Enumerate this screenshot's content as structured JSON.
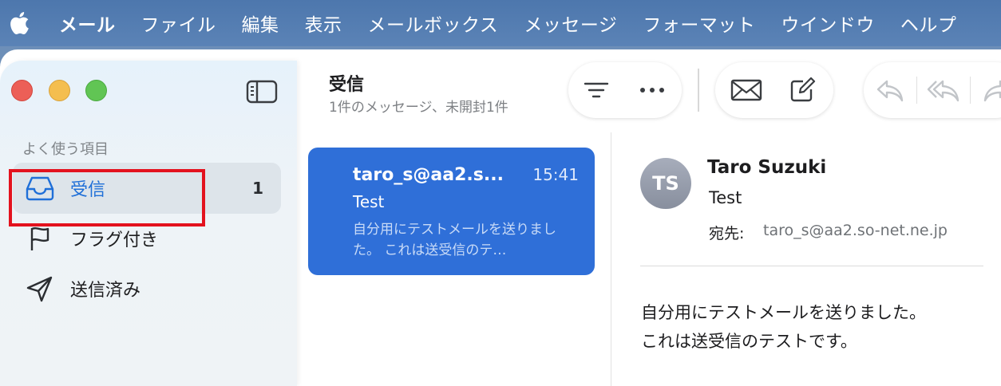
{
  "menubar": {
    "apple_icon": "apple-logo-icon",
    "items": [
      "メール",
      "ファイル",
      "編集",
      "表示",
      "メールボックス",
      "メッセージ",
      "フォーマット",
      "ウインドウ",
      "ヘルプ"
    ]
  },
  "sidebar": {
    "section_title": "よく使う項目",
    "items": [
      {
        "label": "受信",
        "icon": "inbox-tray-icon",
        "count": "1",
        "selected": true
      },
      {
        "label": "フラグ付き",
        "icon": "flag-icon",
        "count": ""
      },
      {
        "label": "送信済み",
        "icon": "paper-plane-icon",
        "count": ""
      }
    ]
  },
  "toolbar": {
    "title": "受信",
    "subtitle": "1件のメッセージ、未開封1件",
    "buttons": [
      "filter-lines-icon",
      "more-dots-icon",
      "envelope-icon",
      "compose-icon",
      "reply-icon",
      "reply-all-icon",
      "forward-icon"
    ]
  },
  "message_list": {
    "messages": [
      {
        "from": "taro_s@aa2.s...",
        "time": "15:41",
        "subject": "Test",
        "preview": "自分用にテストメールを送りました。 これは送受信のテ…"
      }
    ]
  },
  "reading_pane": {
    "avatar_initials": "TS",
    "sender_name": "Taro Suzuki",
    "subject": "Test",
    "to_label": "宛先:",
    "to_address": "taro_s@aa2.so-net.ne.jp",
    "body_lines": [
      "自分用にテストメールを送りました。",
      "これは送受信のテストです。"
    ]
  },
  "colors": {
    "accent": "#2f6fd8",
    "highlight_box": "#e3121e",
    "menubar": "#4d77ad"
  }
}
